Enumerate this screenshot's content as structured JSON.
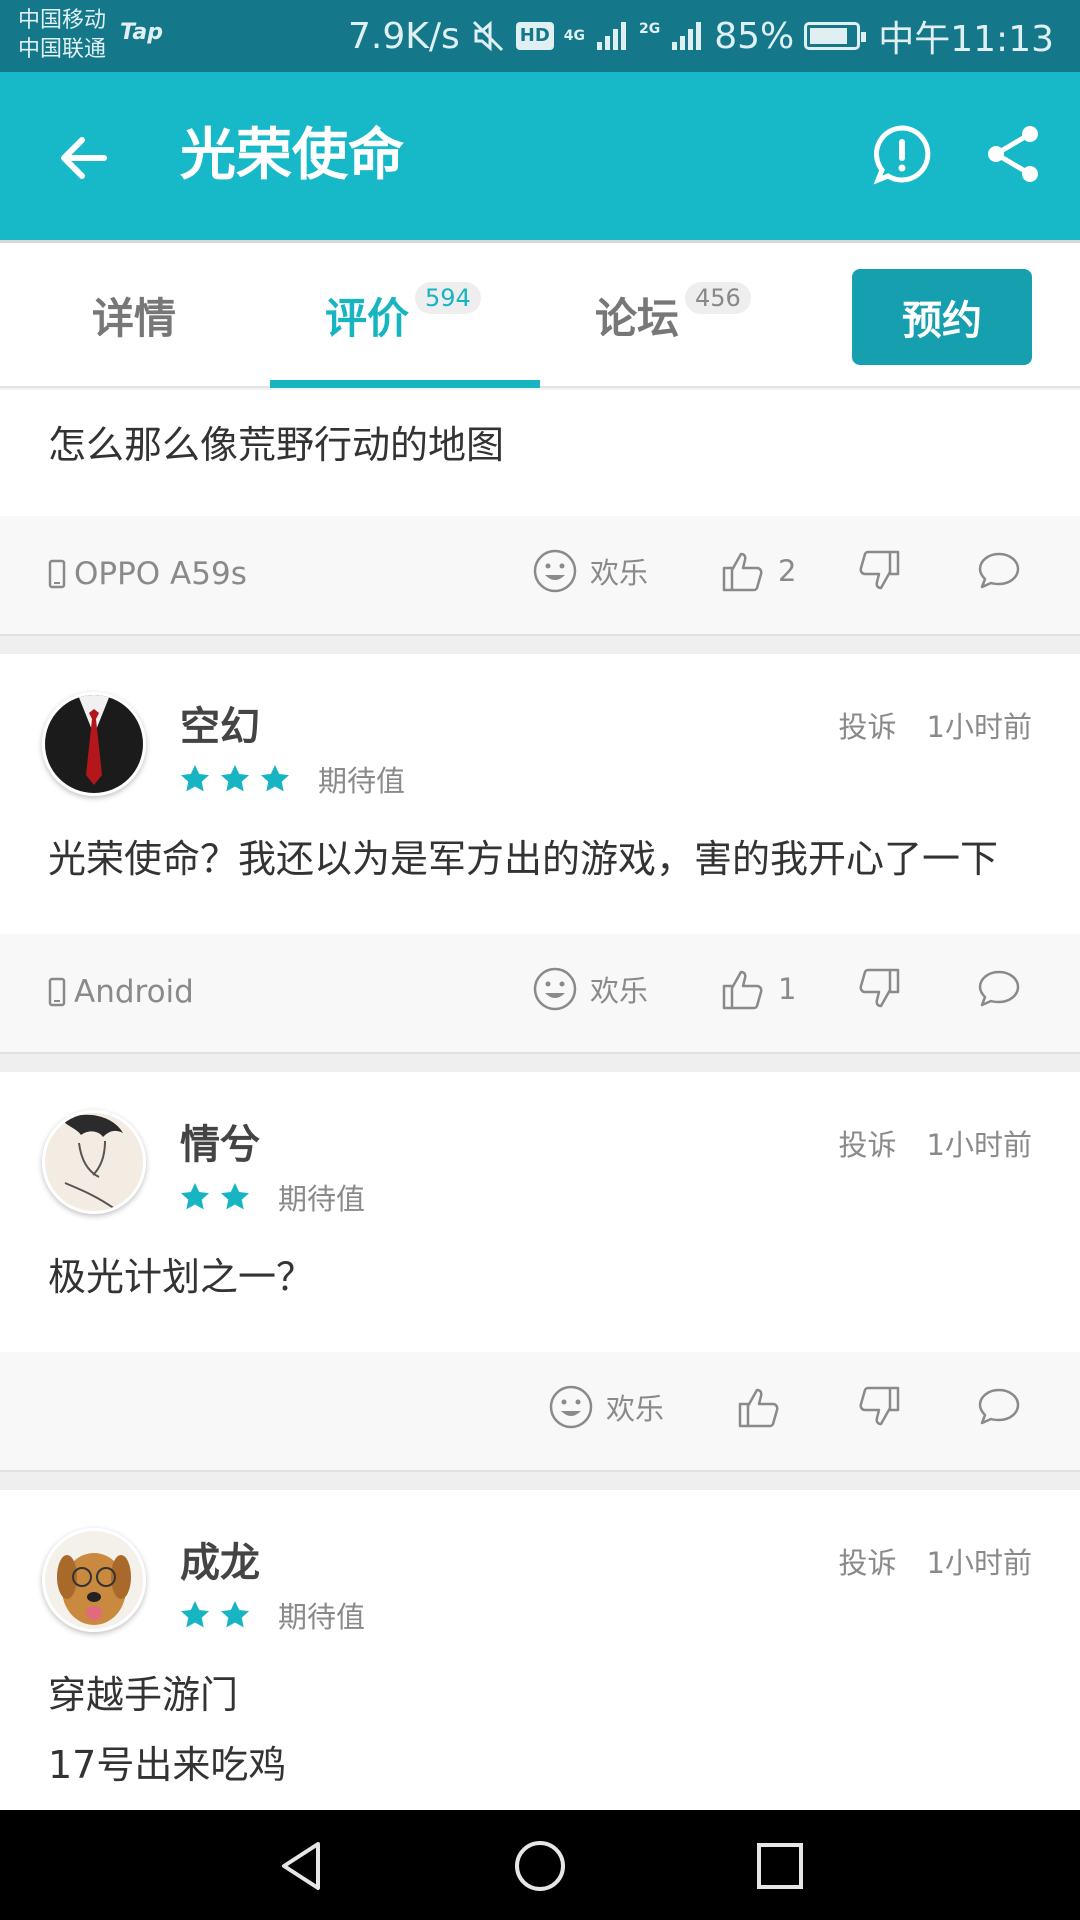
{
  "status_bar": {
    "carrier_1": "中国移动",
    "carrier_2": "中国联通",
    "app_badge": "Tap",
    "net_speed": "7.9K/s",
    "hd_label": "HD",
    "net_4g": "4G",
    "net_2g": "2G",
    "battery": "85%",
    "battery_level": 0.85,
    "time": "中午11:13"
  },
  "toolbar": {
    "title": "光荣使命",
    "back_icon": "arrow-left-icon",
    "report_icon": "exclamation-circle-icon",
    "share_icon": "share-icon"
  },
  "tabs": [
    {
      "label": "详情",
      "badge": ""
    },
    {
      "label": "评价",
      "badge": "594",
      "active": true
    },
    {
      "label": "论坛",
      "badge": "456"
    }
  ],
  "reserve_label": "预约",
  "reviews": [
    {
      "partial": true,
      "text": "怎么那么像荒野行动的地图",
      "device": "OPPO A59s",
      "mood": "欢乐",
      "likes": "2"
    },
    {
      "user": "空幻",
      "stars": 3,
      "expect_label": "期待值",
      "report": "投诉",
      "time": "1小时前",
      "text": "光荣使命？我还以为是军方出的游戏，害的我开心了一下",
      "device": "Android",
      "mood": "欢乐",
      "likes": "1"
    },
    {
      "user": "情兮",
      "stars": 2,
      "expect_label": "期待值",
      "report": "投诉",
      "time": "1小时前",
      "text": "极光计划之一？",
      "device": "",
      "mood": "欢乐",
      "likes": ""
    },
    {
      "user": "成龙",
      "stars": 2,
      "expect_label": "期待值",
      "report": "投诉",
      "time": "1小时前",
      "text": "穿越手游门\n17号出来吃鸡",
      "device": "",
      "mood": "",
      "likes": ""
    }
  ],
  "colors": {
    "accent": "#17b9c8",
    "status_bar": "#14788a",
    "star": "#17b4c2"
  }
}
